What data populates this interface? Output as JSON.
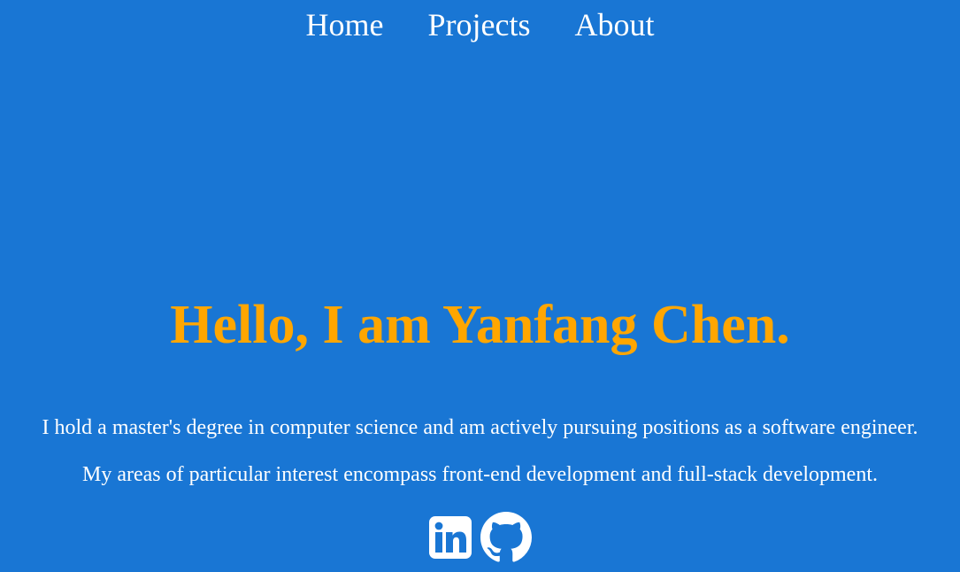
{
  "nav": {
    "items": [
      {
        "label": "Home"
      },
      {
        "label": "Projects"
      },
      {
        "label": "About"
      }
    ]
  },
  "hero": {
    "title": "Hello, I am Yanfang Chen.",
    "line1": "I hold a master's degree in computer science and am actively pursuing positions as a software engineer.",
    "line2": "My areas of particular interest encompass front-end development and full-stack development."
  },
  "socials": [
    {
      "icon": "linkedin-icon"
    },
    {
      "icon": "github-icon"
    }
  ],
  "colors": {
    "background": "#1976d4",
    "accent": "#ffa600",
    "text": "#ffffff"
  }
}
